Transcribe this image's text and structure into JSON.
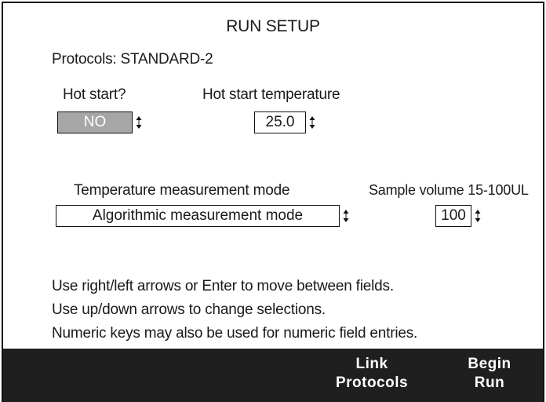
{
  "title": "RUN SETUP",
  "protocols": "Protocols: STANDARD-2",
  "hot_start": {
    "label": "Hot start?",
    "value": "NO"
  },
  "hot_start_temp": {
    "label": "Hot start temperature",
    "value": "25.0"
  },
  "temp_mode": {
    "label": "Temperature measurement mode",
    "value": "Algorithmic measurement mode"
  },
  "sample_volume": {
    "label": "Sample volume 15-100UL",
    "value": "100"
  },
  "instructions": [
    "Use right/left arrows or Enter to move between fields.",
    "Use up/down arrows to change selections.",
    "Numeric keys may also be used for numeric field entries."
  ],
  "softkeys": {
    "link_line1": "Link",
    "link_line2": "Protocols",
    "begin_line1": "Begin",
    "begin_line2": "Run"
  },
  "colors": {
    "selected_field": "#a6a6a6",
    "footer": "#1f1f1f"
  },
  "icons": {
    "spinner": "up-down-arrows-icon"
  }
}
